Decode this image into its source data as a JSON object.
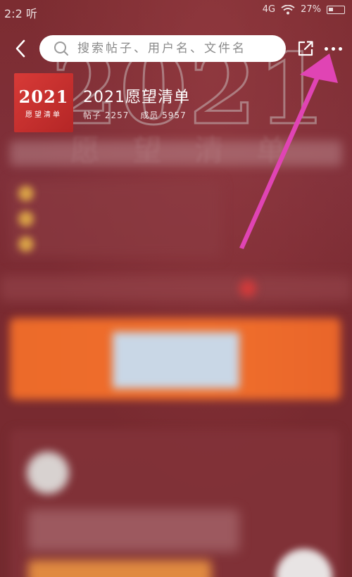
{
  "status_bar": {
    "time": "2:2 听",
    "network": "4G",
    "battery": "27%"
  },
  "header": {
    "back_icon": "chevron-left-icon",
    "search_placeholder": "搜索帖子、用户名、文件名",
    "share_icon": "share-icon",
    "more_icon": "more-horizontal-icon"
  },
  "forum": {
    "avatar_year": "2021",
    "avatar_subtitle": "愿望清单",
    "name": "2021愿望清单",
    "posts_label": "帖子 2257",
    "members_label": "成员 5957"
  },
  "background": {
    "watermark": "2021",
    "watermark_sub": "愿望清单"
  },
  "colors": {
    "background": "#7a2a30",
    "arrow": "#e044b4",
    "banner": "#ec6a2a"
  }
}
